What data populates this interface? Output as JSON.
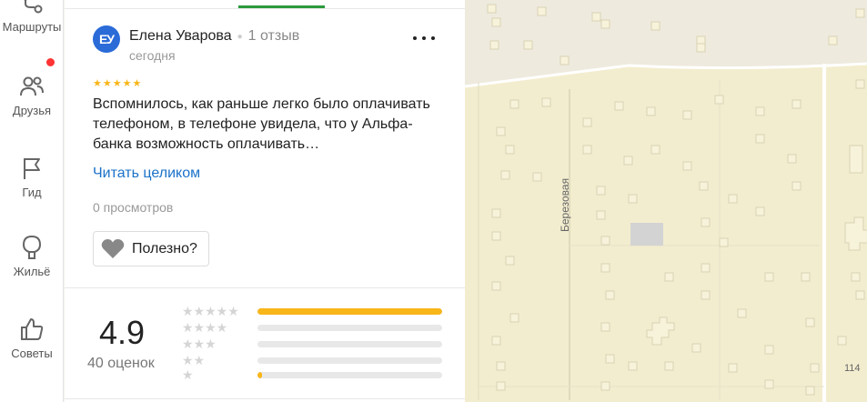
{
  "nav": {
    "items": [
      {
        "label": "Маршруты",
        "icon": "route-icon"
      },
      {
        "label": "Друзья",
        "icon": "friends-icon"
      },
      {
        "label": "Гид",
        "icon": "flag-icon"
      },
      {
        "label": "Жильё",
        "icon": "house-icon"
      },
      {
        "label": "Советы",
        "icon": "thumb-up-icon"
      }
    ]
  },
  "review": {
    "avatar_initials": "ЕУ",
    "author": "Елена Уварова",
    "reviews_count": "1 отзыв",
    "date": "сегодня",
    "rating": 5,
    "text": "Вспомнилось, как раньше легко было оплачивать телефоном, в телефоне увидела, что у Альфа-банка возможность оплачивать…",
    "read_more": "Читать целиком",
    "views": "0 просмотров",
    "useful_label": "Полезно?"
  },
  "rating_summary": {
    "score": "4.9",
    "count_label": "40 оценок",
    "distribution": [
      {
        "stars": 5,
        "fraction": 1.0
      },
      {
        "stars": 4,
        "fraction": 0.0
      },
      {
        "stars": 3,
        "fraction": 0.0
      },
      {
        "stars": 2,
        "fraction": 0.0
      },
      {
        "stars": 1,
        "fraction": 0.025
      }
    ]
  },
  "map": {
    "street_label": "Березовая",
    "house_number": "114"
  },
  "colors": {
    "accent_blue": "#1b72c9",
    "star_yellow": "#f8b619",
    "tab_green": "#2b9a3c",
    "avatar_blue": "#2a6bd8",
    "map_bg": "#f3edcf"
  }
}
